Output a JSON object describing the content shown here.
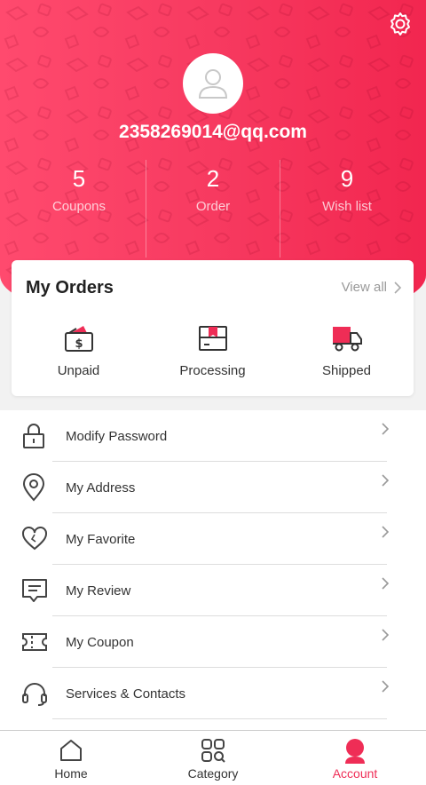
{
  "profile": {
    "email": "2358269014@qq.com"
  },
  "stats": [
    {
      "value": "5",
      "label": "Coupons"
    },
    {
      "value": "2",
      "label": "Order"
    },
    {
      "value": "9",
      "label": "Wish list"
    }
  ],
  "orders": {
    "title": "My Orders",
    "view_all": "View all",
    "items": [
      {
        "label": "Unpaid",
        "icon": "wallet-dollar-icon"
      },
      {
        "label": "Processing",
        "icon": "package-icon"
      },
      {
        "label": "Shipped",
        "icon": "truck-icon"
      }
    ]
  },
  "menu": [
    {
      "label": "Modify Password",
      "icon": "lock-icon"
    },
    {
      "label": "My Address",
      "icon": "location-pin-icon"
    },
    {
      "label": "My Favorite",
      "icon": "heart-icon"
    },
    {
      "label": "My Review",
      "icon": "review-icon"
    },
    {
      "label": "My Coupon",
      "icon": "coupon-icon"
    },
    {
      "label": "Services & Contacts",
      "icon": "headset-icon"
    }
  ],
  "tabbar": [
    {
      "label": "Home",
      "icon": "home-icon",
      "active": false
    },
    {
      "label": "Category",
      "icon": "category-icon",
      "active": false
    },
    {
      "label": "Account",
      "icon": "account-icon",
      "active": true
    }
  ],
  "colors": {
    "accent": "#ef2d56",
    "hero_start": "#ff4a6e",
    "hero_end": "#f2264f"
  }
}
